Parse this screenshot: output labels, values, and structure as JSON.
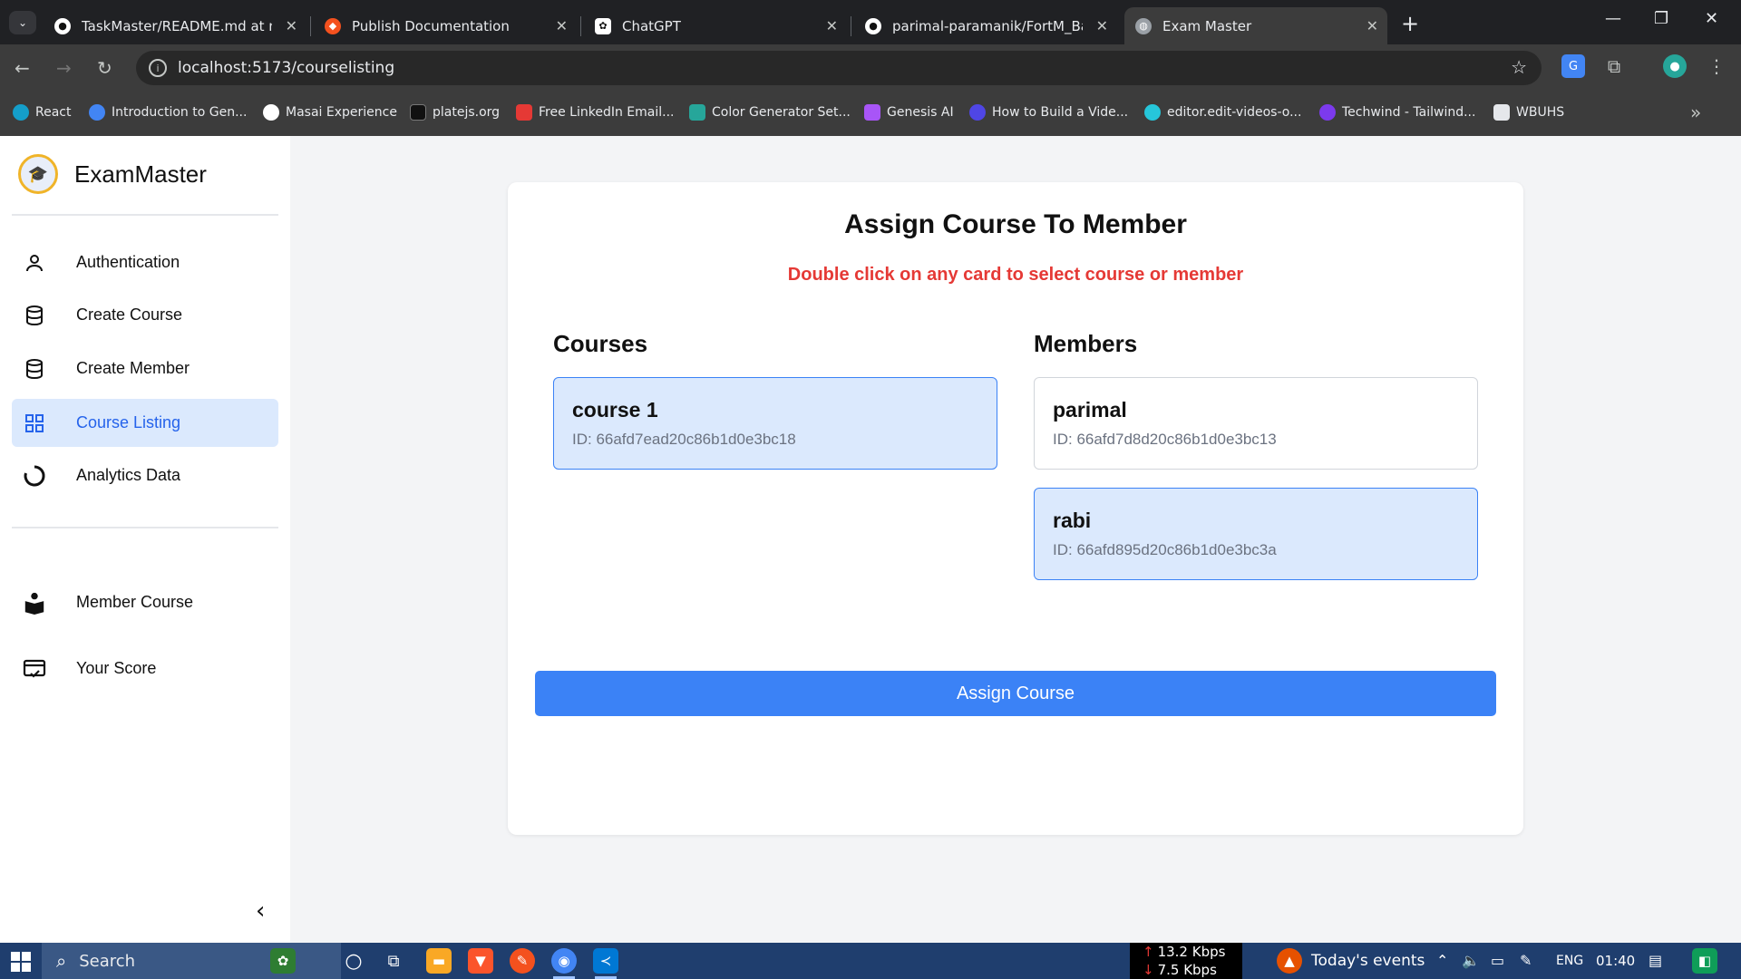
{
  "browser": {
    "tabs": [
      {
        "title": "TaskMaster/README.md at mai",
        "icon": "github-icon",
        "active": false
      },
      {
        "title": "Publish Documentation",
        "icon": "docs-icon",
        "active": false
      },
      {
        "title": "ChatGPT",
        "icon": "chatgpt-icon",
        "active": false
      },
      {
        "title": "parimal-paramanik/FortM_Back",
        "icon": "github-icon",
        "active": false
      },
      {
        "title": "Exam Master",
        "icon": "globe-icon",
        "active": true
      }
    ],
    "url": "localhost:5173/courselisting",
    "bookmarks": [
      {
        "label": "React",
        "color": "#149eca"
      },
      {
        "label": "Introduction to Gen...",
        "color": "#4285f4"
      },
      {
        "label": "Masai Experience",
        "color": "#ffffff"
      },
      {
        "label": "platejs.org",
        "color": "#111111"
      },
      {
        "label": "Free LinkedIn Email...",
        "color": "#e53935"
      },
      {
        "label": "Color Generator Set...",
        "color": "#26a69a"
      },
      {
        "label": "Genesis AI",
        "color": "#a855f7"
      },
      {
        "label": "How to Build a Vide...",
        "color": "#4f46e5"
      },
      {
        "label": "editor.edit-videos-o...",
        "color": "#26c6da"
      },
      {
        "label": "Techwind - Tailwind...",
        "color": "#7c3aed"
      },
      {
        "label": "WBUHS",
        "color": "#e5e7eb"
      }
    ]
  },
  "sidebar": {
    "brand": "ExamMaster",
    "items": [
      {
        "label": "Authentication",
        "icon": "user-icon",
        "active": false
      },
      {
        "label": "Create Course",
        "icon": "database-icon",
        "active": false
      },
      {
        "label": "Create Member",
        "icon": "database-icon",
        "active": false
      },
      {
        "label": "Course Listing",
        "icon": "grid-icon",
        "active": true
      },
      {
        "label": "Analytics Data",
        "icon": "chart-ring-icon",
        "active": false
      }
    ],
    "secondary_items": [
      {
        "label": "Member Course",
        "icon": "reader-icon"
      },
      {
        "label": "Your Score",
        "icon": "score-card-icon"
      }
    ]
  },
  "main": {
    "title": "Assign Course To Member",
    "hint": "Double click on any card to select course or member",
    "courses_title": "Courses",
    "members_title": "Members",
    "courses": [
      {
        "name": "course 1",
        "id": "ID: 66afd7ead20c86b1d0e3bc18",
        "selected": true
      }
    ],
    "members": [
      {
        "name": "parimal",
        "id": "ID: 66afd7d8d20c86b1d0e3bc13",
        "selected": false
      },
      {
        "name": "rabi",
        "id": "ID: 66afd895d20c86b1d0e3bc3a",
        "selected": true
      }
    ],
    "assign_button": "Assign Course"
  },
  "taskbar": {
    "search": "Search",
    "net_up": "13.2 Kbps",
    "net_down": "7.5 Kbps",
    "events": "Today's events",
    "lang": "ENG",
    "time": "01:40"
  },
  "colors": {
    "accent": "#3b82f6",
    "selected_bg": "#dbe9fd",
    "hint_red": "#e53935"
  }
}
